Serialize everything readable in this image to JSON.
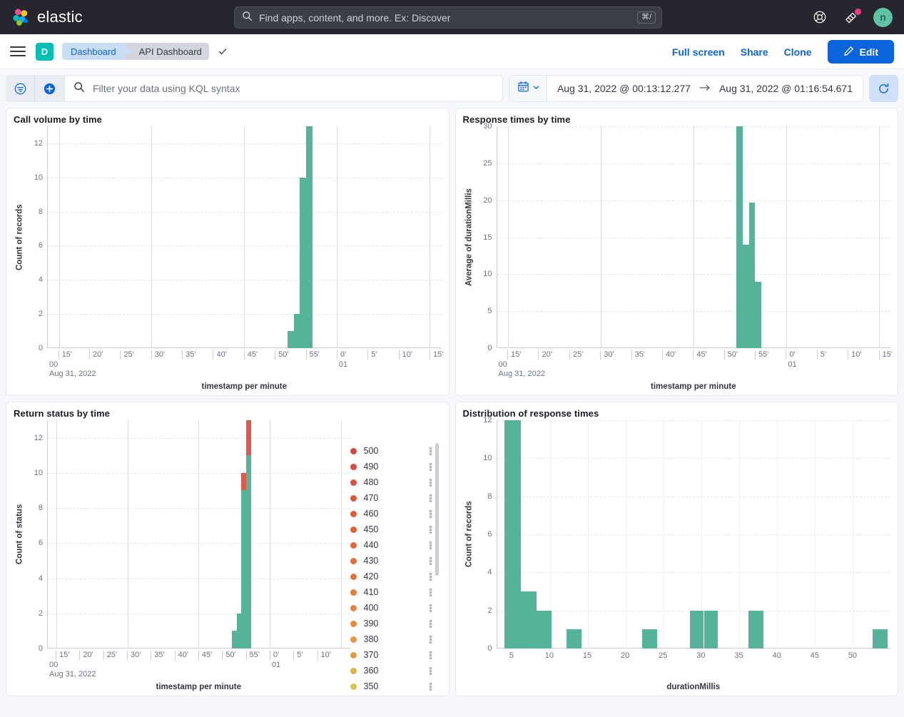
{
  "topbar": {
    "brand": "elastic",
    "search_placeholder": "Find apps, content, and more. Ex: Discover",
    "search_value": "",
    "shortcut": "⌘/",
    "avatar_initial": "n"
  },
  "navbar": {
    "app_badge": "D",
    "breadcrumbs": [
      "Dashboard",
      "API Dashboard"
    ],
    "actions": [
      "Full screen",
      "Share",
      "Clone"
    ],
    "edit_label": "Edit"
  },
  "querybar": {
    "kql_placeholder": "Filter your data using KQL syntax",
    "kql_value": "",
    "date_start": "Aug 31, 2022 @ 00:13:12.277",
    "date_end": "Aug 31, 2022 @ 01:16:54.671",
    "date_separator": "→"
  },
  "colors": {
    "teal": "#54B399",
    "red": "#E1574C",
    "accent_blue": "#0B64DD",
    "elastic_green": "#00BFB3"
  },
  "chart_data": [
    {
      "id": "call-volume-by-time",
      "type": "bar",
      "title": "Call volume by time",
      "xlabel": "timestamp per minute",
      "ylabel": "Count of records",
      "ylim": [
        0,
        13
      ],
      "yticks": [
        0,
        2,
        4,
        6,
        8,
        10,
        12
      ],
      "xticks": [
        "15'",
        "20'",
        "25'",
        "30'",
        "35'",
        "40'",
        "45'",
        "50'",
        "55'",
        "0'",
        "5'",
        "10'",
        "15'"
      ],
      "xsub_left": "00",
      "xsub_date": "Aug 31, 2022",
      "xsub_hour": "01",
      "grid": true,
      "series": [
        {
          "name": "Count of records",
          "color": "#54B399",
          "x": [
            "00:52",
            "00:53",
            "00:54",
            "00:55"
          ],
          "values": [
            1,
            2,
            10,
            13
          ]
        }
      ]
    },
    {
      "id": "response-times-by-time",
      "type": "bar",
      "title": "Response times by time",
      "xlabel": "timestamp per minute",
      "ylabel": "Average of durationMillis",
      "ylim": [
        0,
        30
      ],
      "yticks": [
        0,
        5,
        10,
        15,
        20,
        25,
        30
      ],
      "xticks": [
        "15'",
        "20'",
        "25'",
        "30'",
        "35'",
        "40'",
        "45'",
        "50'",
        "55'",
        "0'",
        "5'",
        "10'",
        "15'"
      ],
      "xsub_left": "00",
      "xsub_date": "Aug 31, 2022",
      "xsub_hour": "01",
      "grid": true,
      "series": [
        {
          "name": "Average of durationMillis",
          "color": "#54B399",
          "x": [
            "00:52",
            "00:53",
            "00:54",
            "00:55"
          ],
          "values": [
            30,
            14,
            19.7,
            9
          ]
        }
      ]
    },
    {
      "id": "return-status-by-time",
      "type": "bar",
      "stacked": true,
      "title": "Return status by time",
      "xlabel": "timestamp per minute",
      "ylabel": "Count of status",
      "ylim": [
        0,
        13
      ],
      "yticks": [
        0,
        2,
        4,
        6,
        8,
        10,
        12
      ],
      "xticks": [
        "15'",
        "20'",
        "25'",
        "30'",
        "35'",
        "40'",
        "45'",
        "50'",
        "55'",
        "0'",
        "5'",
        "10'"
      ],
      "xsub_left": "00",
      "xsub_date": "Aug 31, 2022",
      "xsub_hour": "01",
      "grid": true,
      "x": [
        "00:52",
        "00:53",
        "00:54",
        "00:55"
      ],
      "series": [
        {
          "name": "200",
          "color": "#54B399",
          "values": [
            1,
            2,
            9,
            11
          ]
        },
        {
          "name": "500",
          "color": "#E1574C",
          "values": [
            0,
            0,
            1,
            2
          ]
        }
      ],
      "legend": {
        "position": "right",
        "scrollable": true,
        "items": [
          {
            "label": "500",
            "color": "#D9453C"
          },
          {
            "label": "490",
            "color": "#DB4A3B"
          },
          {
            "label": "480",
            "color": "#DD4F3A"
          },
          {
            "label": "470",
            "color": "#DF5439"
          },
          {
            "label": "460",
            "color": "#E15A39"
          },
          {
            "label": "450",
            "color": "#E25F38"
          },
          {
            "label": "440",
            "color": "#E46538"
          },
          {
            "label": "430",
            "color": "#E56B38"
          },
          {
            "label": "420",
            "color": "#E77238"
          },
          {
            "label": "410",
            "color": "#E97939"
          },
          {
            "label": "400",
            "color": "#EA8139"
          },
          {
            "label": "390",
            "color": "#EB8A3B"
          },
          {
            "label": "380",
            "color": "#EC943E"
          },
          {
            "label": "370",
            "color": "#E0A03F"
          },
          {
            "label": "360",
            "color": "#DFB144"
          },
          {
            "label": "350",
            "color": "#DDC24A"
          }
        ]
      }
    },
    {
      "id": "distribution-of-response-times",
      "type": "bar",
      "title": "Distribution of response times",
      "xlabel": "durationMillis",
      "ylabel": "Count of records",
      "ylim": [
        0,
        12
      ],
      "yticks": [
        0,
        2,
        4,
        6,
        8,
        10,
        12
      ],
      "xticks": [
        5,
        10,
        15,
        20,
        25,
        30,
        35,
        40,
        45,
        50
      ],
      "xlim": [
        3,
        55
      ],
      "grid": true,
      "series": [
        {
          "name": "Count of records",
          "color": "#54B399",
          "bins": [
            {
              "start": 4.0,
              "end": 6.2,
              "value": 12
            },
            {
              "start": 6.2,
              "end": 8.2,
              "value": 3
            },
            {
              "start": 8.2,
              "end": 10.2,
              "value": 2
            },
            {
              "start": 12.2,
              "end": 14.2,
              "value": 1
            },
            {
              "start": 22.2,
              "end": 24.2,
              "value": 1
            },
            {
              "start": 28.5,
              "end": 30.3,
              "value": 2
            },
            {
              "start": 30.4,
              "end": 32.2,
              "value": 2
            },
            {
              "start": 36.2,
              "end": 38.2,
              "value": 2
            },
            {
              "start": 52.6,
              "end": 54.6,
              "value": 1
            }
          ]
        }
      ]
    }
  ]
}
